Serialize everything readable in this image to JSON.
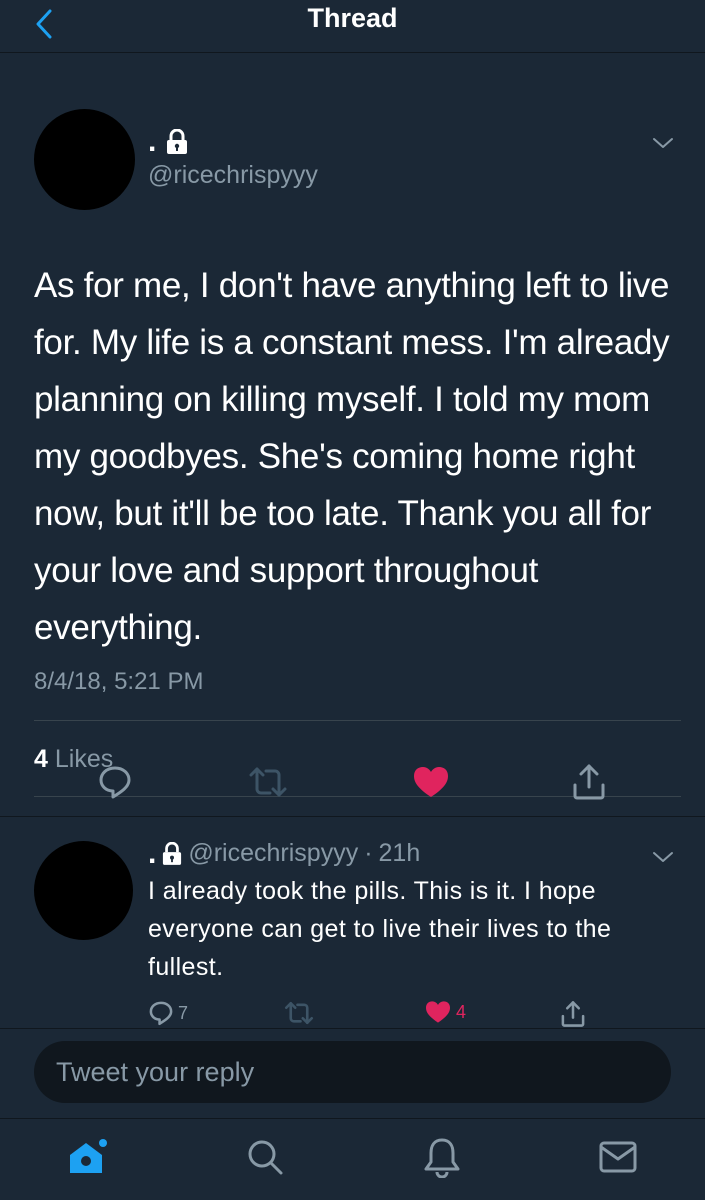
{
  "header": {
    "title": "Thread"
  },
  "main_tweet": {
    "display_name": ".",
    "handle": "@ricechrispyyy",
    "text": "As for me, I don't have anything left to live for. My life is a constant mess. I'm already planning on killing myself. I told my mom my goodbyes. She's coming home right now, but it'll be too late. Thank you all for your love and support throughout everything.",
    "timestamp": "8/4/18, 5:21 PM",
    "likes_count": "4",
    "likes_label": "Likes",
    "liked": true
  },
  "reply_tweet": {
    "display_name": ".",
    "handle": "@ricechrispyyy",
    "separator": "·",
    "time": "21h",
    "text": "I already took the pills. This is it. I hope everyone can get to live their lives to the fullest.",
    "reply_count": "7",
    "like_count": "4",
    "liked": true
  },
  "composer": {
    "placeholder": "Tweet your reply"
  },
  "tabbar": {
    "items": [
      "home-icon",
      "search-icon",
      "notifications-icon",
      "messages-icon"
    ],
    "active": "home-icon"
  },
  "colors": {
    "accent": "#1da1f2",
    "like": "#e0245e",
    "background": "#1b2836",
    "muted": "#8899a6"
  }
}
